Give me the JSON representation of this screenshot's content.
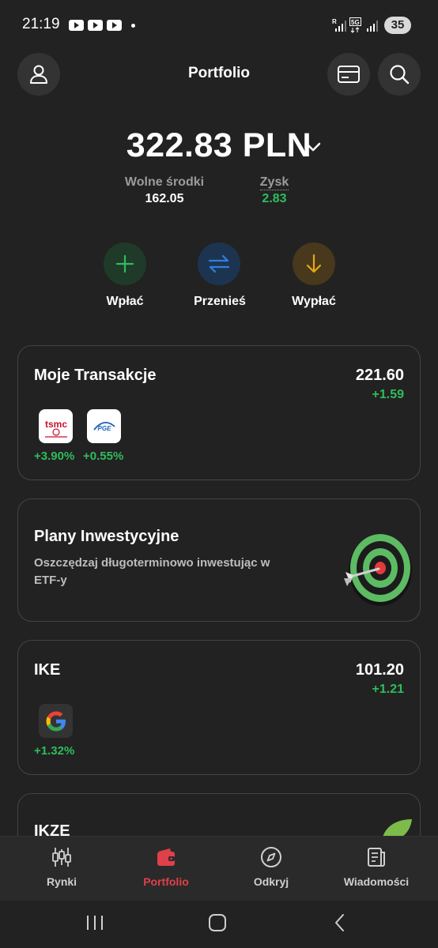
{
  "status_bar": {
    "time": "21:19",
    "battery": "35",
    "icons": [
      "youtube-icon",
      "youtube-icon",
      "youtube-icon",
      "notification-dot",
      "roaming-signal-icon",
      "5g-icon",
      "signal-icon",
      "battery-icon"
    ]
  },
  "header": {
    "title": "Portfolio",
    "icons": [
      "profile-icon",
      "card-icon",
      "search-icon"
    ]
  },
  "balance": {
    "amount": "322.83 PLN",
    "free_funds_label": "Wolne środki",
    "free_funds_value": "162.05",
    "profit_label": "Zysk",
    "profit_value": "2.83"
  },
  "actions": [
    {
      "label": "Wpłać",
      "icon": "plus-icon",
      "color": "#2ebd5c"
    },
    {
      "label": "Przenieś",
      "icon": "transfer-icon",
      "color": "#2f7fe0"
    },
    {
      "label": "Wypłać",
      "icon": "arrow-down-icon",
      "color": "#e6a817"
    }
  ],
  "cards": {
    "transactions": {
      "title": "Moje Transakcje",
      "value": "221.60",
      "change": "+1.59",
      "assets": [
        {
          "logo": "tsmc",
          "change": "+3.90%"
        },
        {
          "logo": "PGE",
          "change": "+0.55%"
        }
      ]
    },
    "plans": {
      "title": "Plany Inwestycyjne",
      "subtitle": "Oszczędzaj długoterminowo inwestując w ETF-y",
      "icon": "target-icon"
    },
    "ike": {
      "title": "IKE",
      "value": "101.20",
      "change": "+1.21",
      "assets": [
        {
          "logo": "google",
          "change": "+1.32%"
        }
      ]
    },
    "ikze": {
      "title": "IKZE",
      "icon": "leaf-icon"
    }
  },
  "bottom_nav": [
    {
      "label": "Rynki",
      "icon": "candlestick-icon",
      "active": false
    },
    {
      "label": "Portfolio",
      "icon": "wallet-icon",
      "active": true
    },
    {
      "label": "Odkryj",
      "icon": "compass-icon",
      "active": false
    },
    {
      "label": "Wiadomości",
      "icon": "news-icon",
      "active": false
    }
  ],
  "colors": {
    "background": "#222222",
    "positive": "#2ebd5c",
    "accent": "#e0404a"
  }
}
